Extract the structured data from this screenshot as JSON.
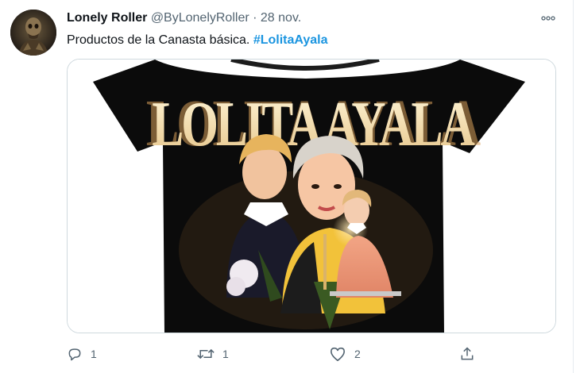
{
  "tweet": {
    "display_name": "Lonely Roller",
    "handle": "@ByLonelyRoller",
    "separator": "·",
    "date": "28 nov.",
    "text": "Productos de la Canasta básica.",
    "hashtag": "#LolitaAyala",
    "avatar": {
      "description_icon": "profile-avatar"
    },
    "media": {
      "shirt_print_text": "LOLITA AYALA"
    },
    "actions": {
      "reply": {
        "icon": "reply-icon",
        "count": "1"
      },
      "retweet": {
        "icon": "retweet-icon",
        "count": "1"
      },
      "like": {
        "icon": "heart-icon",
        "count": "2"
      },
      "share": {
        "icon": "share-icon"
      }
    }
  },
  "colors": {
    "link": "#1b95e0",
    "muted": "#536471",
    "text": "#0f1419",
    "border": "#cfd9de"
  }
}
